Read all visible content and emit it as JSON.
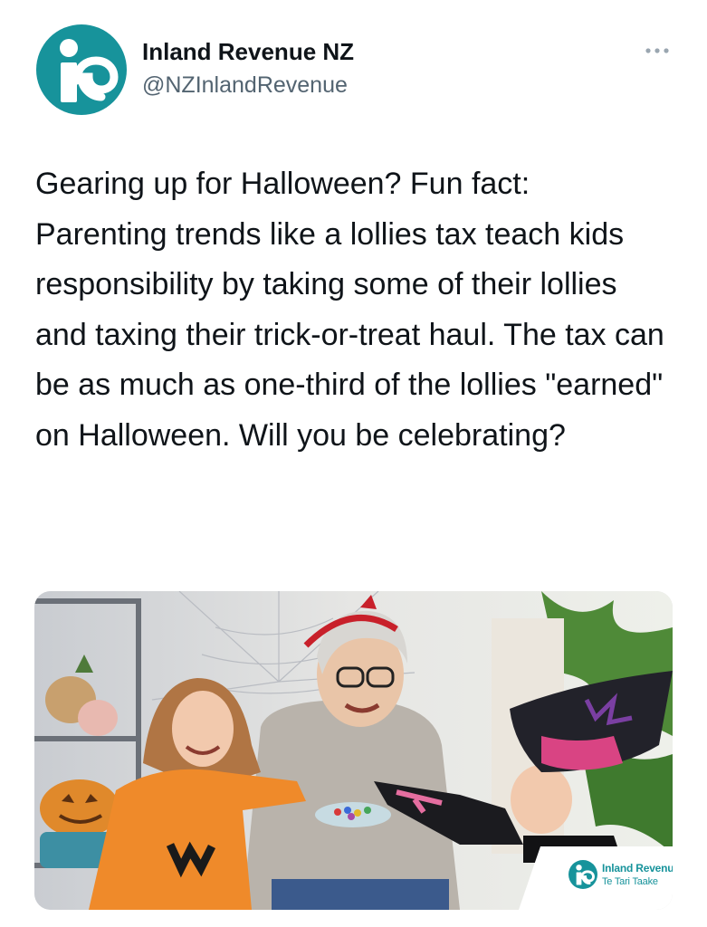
{
  "tweet": {
    "author": {
      "display_name": "Inland Revenue NZ",
      "handle": "@NZInlandRevenue",
      "avatar_icon": "inland-revenue-logo-icon"
    },
    "more_icon": "more-dots-icon",
    "text": "Gearing up for Halloween? Fun fact: Parenting trends like a lollies tax teach kids responsibility by taking some of their lollies and taxing their trick-or-treat haul. The tax can be as much as one-third of the lollies \"earned\" on Halloween. Will you be celebrating?",
    "media": {
      "watermark": {
        "name": "Inland Revenue",
        "subtitle": "Te Tari Taake"
      }
    }
  },
  "colors": {
    "brand_teal": "#17939b",
    "text_primary": "#0f1419",
    "text_secondary": "#536471"
  }
}
